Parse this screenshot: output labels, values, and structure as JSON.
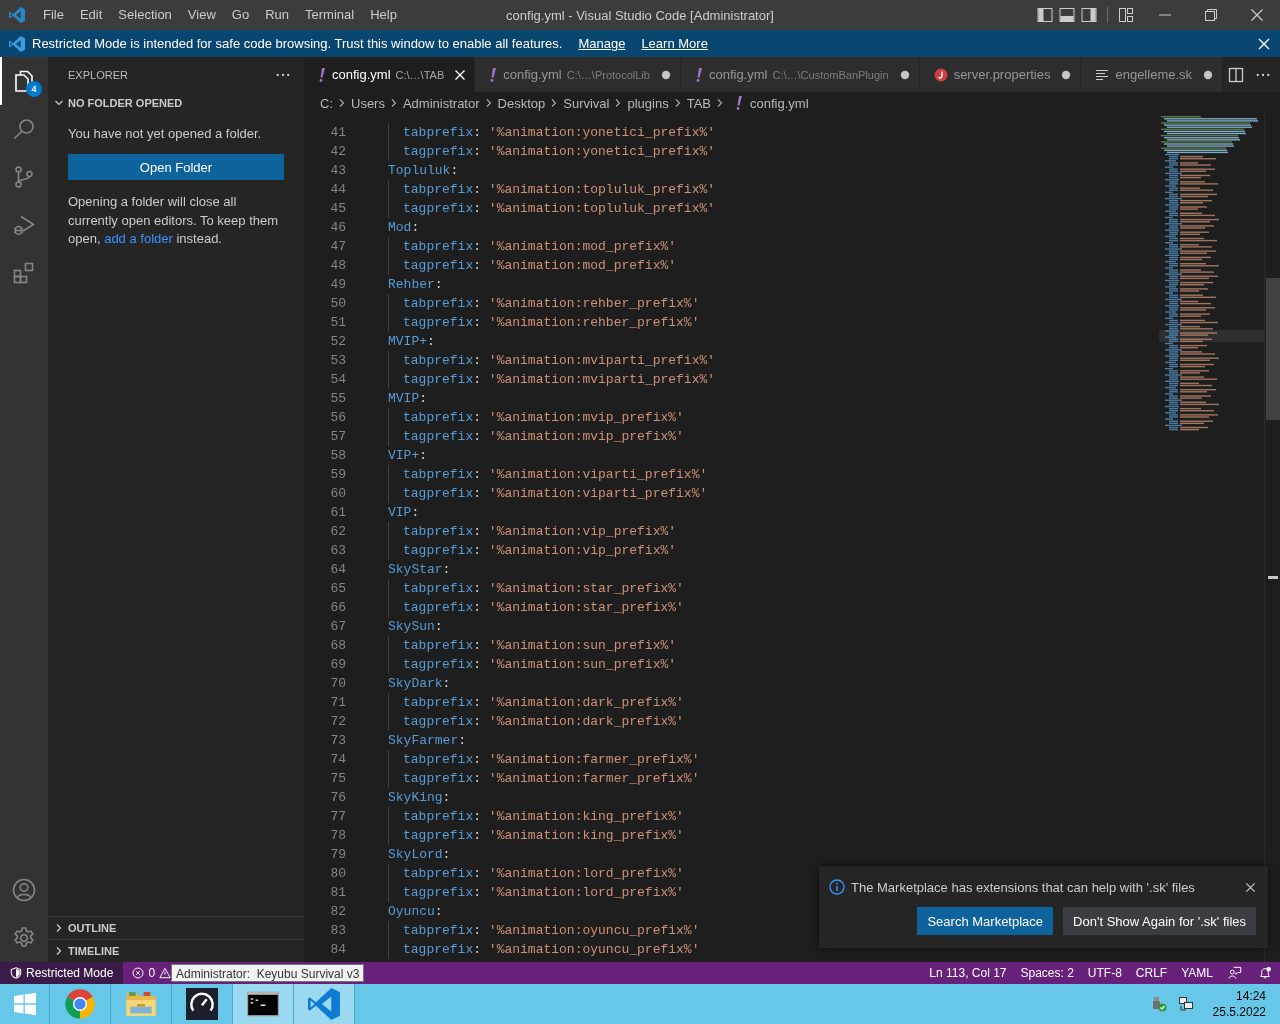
{
  "title_bar": {
    "menu": [
      "File",
      "Edit",
      "Selection",
      "View",
      "Go",
      "Run",
      "Terminal",
      "Help"
    ],
    "title": "config.yml - Visual Studio Code [Administrator]"
  },
  "banner": {
    "message": "Restricted Mode is intended for safe code browsing. Trust this window to enable all features.",
    "links": [
      "Manage",
      "Learn More"
    ]
  },
  "activity_bar": {
    "items": [
      {
        "kind": "explorer",
        "selected": true,
        "badge": "4"
      },
      {
        "kind": "search",
        "selected": false
      },
      {
        "kind": "source-control",
        "selected": false
      },
      {
        "kind": "run-debug",
        "selected": false
      },
      {
        "kind": "extensions",
        "selected": false
      }
    ],
    "bottom": [
      {
        "kind": "accounts"
      },
      {
        "kind": "manage"
      }
    ]
  },
  "sidebar": {
    "title": "EXPLORER",
    "section": {
      "title": "NO FOLDER OPENED",
      "expanded": true,
      "message": "You have not yet opened a folder.",
      "button": "Open Folder",
      "note": "Opening a folder will close all currently open editors. To keep them open,",
      "note_link": "add a folder",
      "note_end": "instead."
    },
    "panels": [
      {
        "title": "OUTLINE",
        "expanded": false
      },
      {
        "title": "TIMELINE",
        "expanded": false
      }
    ]
  },
  "tabs": [
    {
      "kind": "yaml",
      "name": "config.yml",
      "path": "C:\\…\\TAB",
      "selected": true,
      "dirty": false
    },
    {
      "kind": "yaml",
      "name": "config.yml",
      "path": "C:\\…\\ProtocolLib",
      "selected": false,
      "dirty": true
    },
    {
      "kind": "yaml",
      "name": "config.yml",
      "path": "C:\\…\\CustomBanPlugin",
      "selected": false,
      "dirty": true
    },
    {
      "kind": "properties",
      "name": "server.properties",
      "selected": false,
      "dirty": true
    },
    {
      "kind": "text",
      "name": "engelleme.sk",
      "selected": false,
      "dirty": true
    }
  ],
  "breadcrumbs": [
    {
      "kind": "folder",
      "label": "C:"
    },
    {
      "kind": "folder",
      "label": "Users"
    },
    {
      "kind": "folder",
      "label": "Administrator"
    },
    {
      "kind": "folder",
      "label": "Desktop"
    },
    {
      "kind": "folder",
      "label": "Survival"
    },
    {
      "kind": "folder",
      "label": "plugins"
    },
    {
      "kind": "folder",
      "label": "TAB"
    },
    {
      "kind": "yaml",
      "label": "config.yml"
    }
  ],
  "editor": {
    "lines": [
      {
        "n": "41",
        "kind": "entry",
        "key": "tabprefix",
        "sep": ":",
        "value": "'%animation:yonetici_prefix%'"
      },
      {
        "n": "42",
        "kind": "entry",
        "key": "tagprefix",
        "sep": ":",
        "value": "'%animation:yonetici_prefix%'"
      },
      {
        "n": "43",
        "kind": "group",
        "key": "Topluluk",
        "sep": ":"
      },
      {
        "n": "44",
        "kind": "entry",
        "key": "tabprefix",
        "sep": ":",
        "value": "'%animation:topluluk_prefix%'"
      },
      {
        "n": "45",
        "kind": "entry",
        "key": "tagprefix",
        "sep": ":",
        "value": "'%animation:topluluk_prefix%'"
      },
      {
        "n": "46",
        "kind": "group",
        "key": "Mod",
        "sep": ":"
      },
      {
        "n": "47",
        "kind": "entry",
        "key": "tabprefix",
        "sep": ":",
        "value": "'%animation:mod_prefix%'"
      },
      {
        "n": "48",
        "kind": "entry",
        "key": "tagprefix",
        "sep": ":",
        "value": "'%animation:mod_prefix%'"
      },
      {
        "n": "49",
        "kind": "group",
        "key": "Rehber",
        "sep": ":"
      },
      {
        "n": "50",
        "kind": "entry",
        "key": "tabprefix",
        "sep": ":",
        "value": "'%animation:rehber_prefix%'"
      },
      {
        "n": "51",
        "kind": "entry",
        "key": "tagprefix",
        "sep": ":",
        "value": "'%animation:rehber_prefix%'"
      },
      {
        "n": "52",
        "kind": "group",
        "key": "MVIP+",
        "sep": ":"
      },
      {
        "n": "53",
        "kind": "entry",
        "key": "tabprefix",
        "sep": ":",
        "value": "'%animation:mviparti_prefix%'"
      },
      {
        "n": "54",
        "kind": "entry",
        "key": "tagprefix",
        "sep": ":",
        "value": "'%animation:mviparti_prefix%'"
      },
      {
        "n": "55",
        "kind": "group",
        "key": "MVIP",
        "sep": ":"
      },
      {
        "n": "56",
        "kind": "entry",
        "key": "tabprefix",
        "sep": ":",
        "value": "'%animation:mvip_prefix%'"
      },
      {
        "n": "57",
        "kind": "entry",
        "key": "tagprefix",
        "sep": ":",
        "value": "'%animation:mvip_prefix%'"
      },
      {
        "n": "58",
        "kind": "group",
        "key": "VIP+",
        "sep": ":"
      },
      {
        "n": "59",
        "kind": "entry",
        "key": "tabprefix",
        "sep": ":",
        "value": "'%animation:viparti_prefix%'"
      },
      {
        "n": "60",
        "kind": "entry",
        "key": "tagprefix",
        "sep": ":",
        "value": "'%animation:viparti_prefix%'"
      },
      {
        "n": "61",
        "kind": "group",
        "key": "VIP",
        "sep": ":"
      },
      {
        "n": "62",
        "kind": "entry",
        "key": "tabprefix",
        "sep": ":",
        "value": "'%animation:vip_prefix%'"
      },
      {
        "n": "63",
        "kind": "entry",
        "key": "tagprefix",
        "sep": ":",
        "value": "'%animation:vip_prefix%'"
      },
      {
        "n": "64",
        "kind": "group",
        "key": "SkyStar",
        "sep": ":"
      },
      {
        "n": "65",
        "kind": "entry",
        "key": "tabprefix",
        "sep": ":",
        "value": "'%animation:star_prefix%'"
      },
      {
        "n": "66",
        "kind": "entry",
        "key": "tagprefix",
        "sep": ":",
        "value": "'%animation:star_prefix%'"
      },
      {
        "n": "67",
        "kind": "group",
        "key": "SkySun",
        "sep": ":"
      },
      {
        "n": "68",
        "kind": "entry",
        "key": "tabprefix",
        "sep": ":",
        "value": "'%animation:sun_prefix%'"
      },
      {
        "n": "69",
        "kind": "entry",
        "key": "tagprefix",
        "sep": ":",
        "value": "'%animation:sun_prefix%'"
      },
      {
        "n": "70",
        "kind": "group",
        "key": "SkyDark",
        "sep": ":"
      },
      {
        "n": "71",
        "kind": "entry",
        "key": "tabprefix",
        "sep": ":",
        "value": "'%animation:dark_prefix%'"
      },
      {
        "n": "72",
        "kind": "entry",
        "key": "tagprefix",
        "sep": ":",
        "value": "'%animation:dark_prefix%'"
      },
      {
        "n": "73",
        "kind": "group",
        "key": "SkyFarmer",
        "sep": ":"
      },
      {
        "n": "74",
        "kind": "entry",
        "key": "tabprefix",
        "sep": ":",
        "value": "'%animation:farmer_prefix%'"
      },
      {
        "n": "75",
        "kind": "entry",
        "key": "tagprefix",
        "sep": ":",
        "value": "'%animation:farmer_prefix%'"
      },
      {
        "n": "76",
        "kind": "group",
        "key": "SkyKing",
        "sep": ":"
      },
      {
        "n": "77",
        "kind": "entry",
        "key": "tabprefix",
        "sep": ":",
        "value": "'%animation:king_prefix%'"
      },
      {
        "n": "78",
        "kind": "entry",
        "key": "tagprefix",
        "sep": ":",
        "value": "'%animation:king_prefix%'"
      },
      {
        "n": "79",
        "kind": "group",
        "key": "SkyLord",
        "sep": ":"
      },
      {
        "n": "80",
        "kind": "entry",
        "key": "tabprefix",
        "sep": ":",
        "value": "'%animation:lord_prefix%'"
      },
      {
        "n": "81",
        "kind": "entry",
        "key": "tagprefix",
        "sep": ":",
        "value": "'%animation:lord_prefix%'"
      },
      {
        "n": "82",
        "kind": "group",
        "key": "Oyuncu",
        "sep": ":"
      },
      {
        "n": "83",
        "kind": "entry",
        "key": "tabprefix",
        "sep": ":",
        "value": "'%animation:oyuncu_prefix%'"
      },
      {
        "n": "84",
        "kind": "entry",
        "key": "tagprefix",
        "sep": ":",
        "value": "'%animation:oyuncu_prefix%'"
      }
    ]
  },
  "notification": {
    "message": "The Marketplace has extensions that can help with '.sk' files",
    "buttons": [
      {
        "kind": "primary",
        "label": "Search Marketplace"
      },
      {
        "kind": "secondary",
        "label": "Don't Show Again for '.sk' files"
      }
    ]
  },
  "status_bar": {
    "restricted_mode": "Restricted Mode",
    "errors": "0",
    "tooltip": "Administrator:  Keyubu Survival v3",
    "items": [
      "Ln 113, Col 17",
      "Spaces: 2",
      "UTF-8",
      "CRLF",
      "YAML"
    ]
  },
  "taskbar": {
    "apps": [
      {
        "kind": "start",
        "active": false
      },
      {
        "kind": "browser",
        "active": false
      },
      {
        "kind": "folder",
        "active": false
      },
      {
        "kind": "gauge",
        "active": false
      },
      {
        "kind": "terminal",
        "active": true
      },
      {
        "kind": "editor",
        "active": true
      }
    ],
    "time": "14:24",
    "date": "25.5.2022"
  }
}
